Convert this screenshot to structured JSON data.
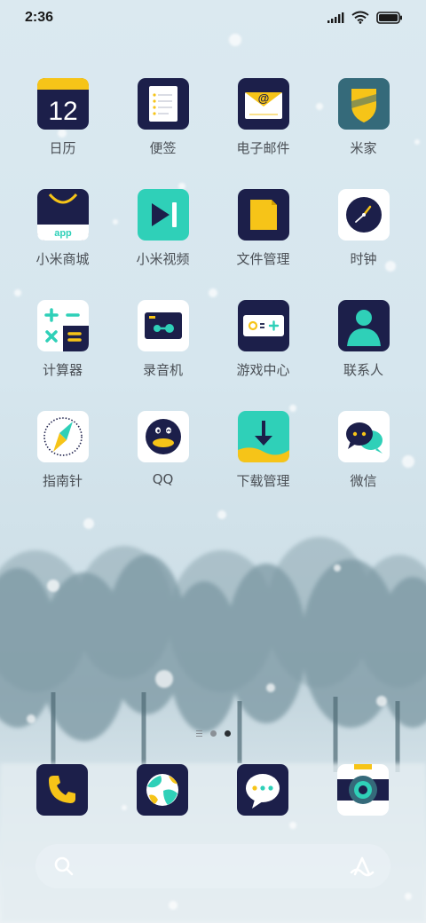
{
  "status_bar": {
    "time": "2:36",
    "icons": [
      "signal-icon",
      "wifi-icon",
      "battery-icon"
    ]
  },
  "apps": [
    {
      "label": "日历",
      "icon": "calendar-icon",
      "badge_text": "12"
    },
    {
      "label": "便签",
      "icon": "notes-icon"
    },
    {
      "label": "电子邮件",
      "icon": "email-icon"
    },
    {
      "label": "米家",
      "icon": "mijia-icon"
    },
    {
      "label": "小米商城",
      "icon": "mi-store-icon",
      "badge_text": "app"
    },
    {
      "label": "小米视频",
      "icon": "mi-video-icon"
    },
    {
      "label": "文件管理",
      "icon": "file-manager-icon"
    },
    {
      "label": "时钟",
      "icon": "clock-icon"
    },
    {
      "label": "计算器",
      "icon": "calculator-icon"
    },
    {
      "label": "录音机",
      "icon": "recorder-icon"
    },
    {
      "label": "游戏中心",
      "icon": "game-center-icon"
    },
    {
      "label": "联系人",
      "icon": "contacts-icon"
    },
    {
      "label": "指南针",
      "icon": "compass-icon"
    },
    {
      "label": "QQ",
      "icon": "qq-icon"
    },
    {
      "label": "下载管理",
      "icon": "download-manager-icon"
    },
    {
      "label": "微信",
      "icon": "wechat-icon"
    }
  ],
  "page_indicator": {
    "pages": 3,
    "active_index": 2
  },
  "dock": [
    {
      "icon": "phone-icon"
    },
    {
      "icon": "browser-icon"
    },
    {
      "icon": "messages-icon"
    },
    {
      "icon": "camera-icon"
    }
  ],
  "search_bar": {
    "placeholder": "",
    "icons": [
      "search-icon",
      "assistant-icon"
    ]
  },
  "colors": {
    "navy": "#1c1f4a",
    "yellow": "#f6c418",
    "teal": "#2fd0b8",
    "teal_dark": "#356a7a",
    "white": "#ffffff"
  }
}
